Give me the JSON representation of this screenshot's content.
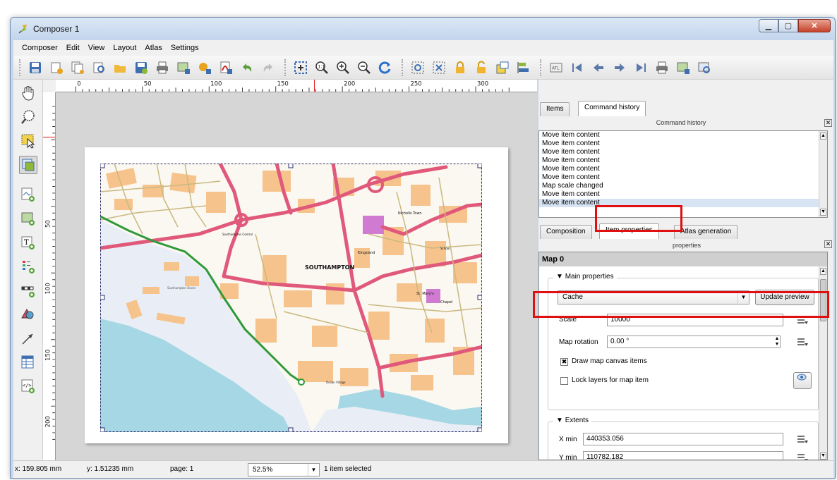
{
  "window": {
    "title": "Composer 1"
  },
  "menu": [
    "Composer",
    "Edit",
    "View",
    "Layout",
    "Atlas",
    "Settings"
  ],
  "ruler": {
    "top_labels": [
      "0",
      "50",
      "100",
      "150",
      "200",
      "250",
      "300"
    ],
    "left_labels": [
      "50",
      "100",
      "150",
      "200"
    ]
  },
  "map": {
    "labels": {
      "city": "SOUTHAMPTON",
      "docks": "Southampton Docks",
      "park": "Kingsland",
      "church": "St. Mary's",
      "chapel": "Chapel",
      "nicholls": "Nicholls Town",
      "school": "School",
      "station": "Southampton Central",
      "quays": "Ocean Village"
    },
    "colors": {
      "water": "#a6d7e4",
      "land_pale": "#e9eef6",
      "buildings": "#f6c38c",
      "roads_major": "#e0597a",
      "roads_minor": "#ffffff",
      "rail": "#2f9a3a"
    }
  },
  "panel": {
    "top_tabs": [
      "Items",
      "Command history"
    ],
    "history_title": "Command history",
    "history_items": [
      "Move item content",
      "Move item content",
      "Move item content",
      "Move item content",
      "Move item content",
      "Move item content",
      "Map scale changed",
      "Move item content",
      "Move item content"
    ],
    "bottom_tabs": [
      "Composition",
      "Item properties",
      "Atlas generation"
    ],
    "item_title_partial": "properties",
    "item_name": "Map 0",
    "main_properties": {
      "title": "Main properties",
      "cache_value": "Cache",
      "update_preview": "Update preview",
      "scale_label": "Scale",
      "scale_value": "10000",
      "rotation_label": "Map rotation",
      "rotation_value": "0.00 °",
      "draw_canvas_label": "Draw map canvas items",
      "draw_canvas_checked": true,
      "lock_layers_label": "Lock layers for map item",
      "lock_layers_checked": false
    },
    "extents": {
      "title": "Extents",
      "xmin_label": "X min",
      "xmin_value": "440353.056",
      "ymin_label": "Y min",
      "ymin_value": "110782.182"
    }
  },
  "status": {
    "x": "x: 159.805 mm",
    "y": "y: 1.51235 mm",
    "page": "page: 1",
    "zoom": "52.5%",
    "selection": "1 item selected"
  },
  "accent": "#e01010"
}
